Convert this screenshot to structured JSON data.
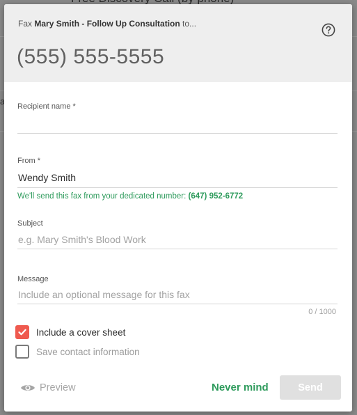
{
  "background": {
    "title": "Free Discovery Call (by phone)"
  },
  "header": {
    "fax_prefix": "Fax",
    "fax_subject": "Mary Smith - Follow Up Consultation",
    "fax_suffix": "to...",
    "fax_number": "(555) 555-5555",
    "help_icon": "question-circle-icon"
  },
  "form": {
    "recipient": {
      "label": "Recipient name *",
      "value": ""
    },
    "from": {
      "label": "From *",
      "value": "Wendy Smith",
      "hint_text": "We'll send this fax from your dedicated number:",
      "hint_number": "(647) 952-6772"
    },
    "subject": {
      "label": "Subject",
      "placeholder": "e.g. Mary Smith's Blood Work"
    },
    "message": {
      "label": "Message",
      "placeholder": "Include an optional message for this fax",
      "counter": "0 / 1000"
    },
    "cover_sheet": {
      "label": "Include a cover sheet",
      "checked": true
    },
    "save_contact": {
      "label": "Save contact information",
      "checked": false
    }
  },
  "footer": {
    "preview_label": "Preview",
    "preview_icon": "eye-icon",
    "never_mind_label": "Never mind",
    "send_label": "Send"
  },
  "colors": {
    "accent_green": "#2e9b5c",
    "checkbox_red": "#ef5a4f",
    "header_bg": "#eeeeee",
    "disabled_button": "#e0e0e0"
  }
}
